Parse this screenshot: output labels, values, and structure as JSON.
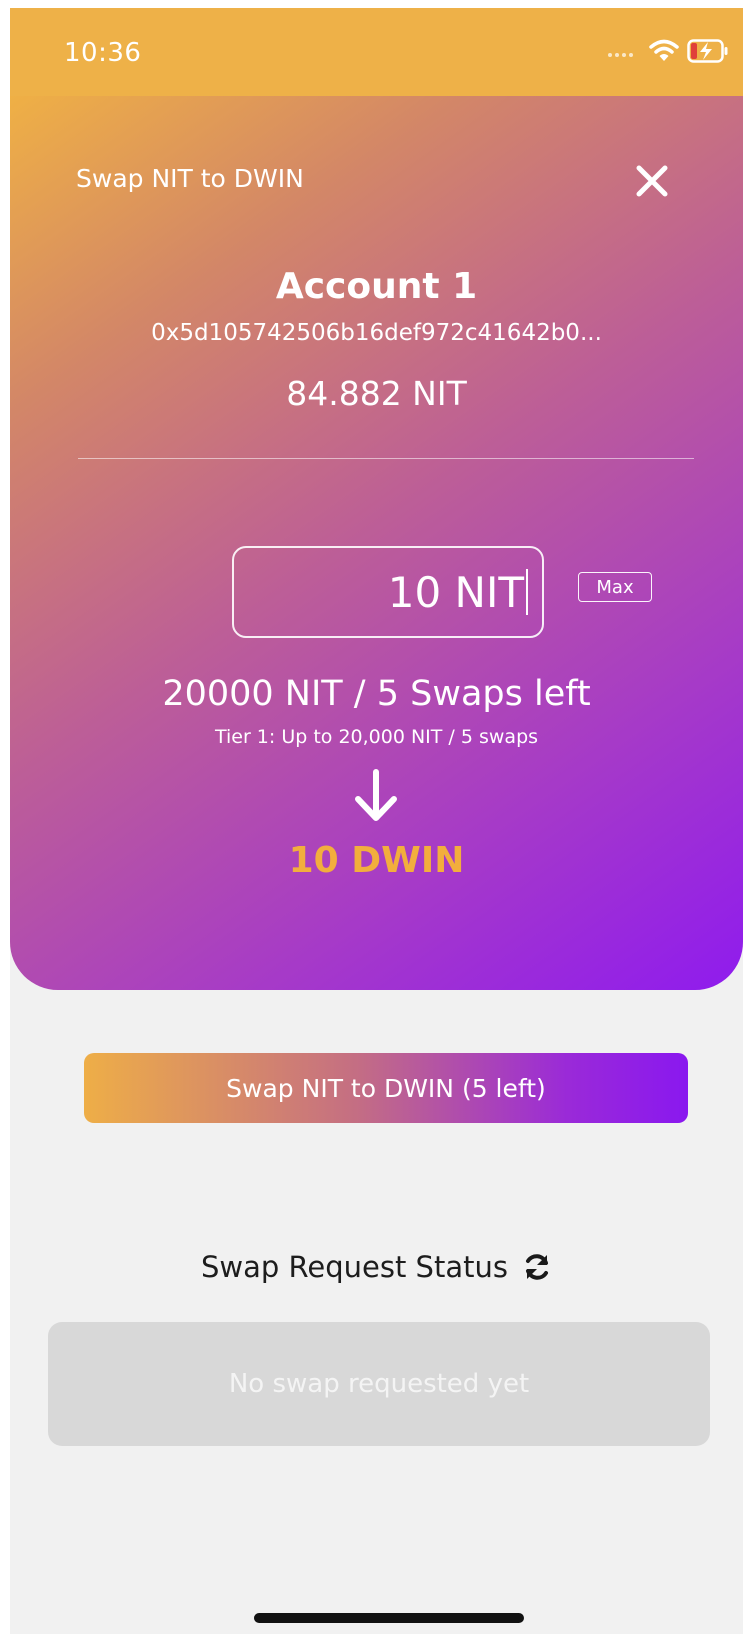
{
  "status_bar": {
    "time": "10:36",
    "icons": [
      "signal-icon",
      "wifi-icon",
      "battery-charging-icon"
    ],
    "color": "#eeb148"
  },
  "header": {
    "title": "Swap NIT to DWIN",
    "close_icon": "close-icon"
  },
  "account": {
    "name": "Account 1",
    "address": "0x5d105742506b16def972c41642b0...",
    "balance": "84.882 NIT"
  },
  "swap_form": {
    "amount_value": "10 NIT",
    "max_label": "Max",
    "limit_text": "20000 NIT / 5 Swaps left",
    "tier_text": "Tier 1: Up to 20,000 NIT / 5 swaps",
    "arrow_icon": "arrow-down-icon",
    "receive_amount": "10 DWIN",
    "receive_color": "#f2ae3d"
  },
  "swap_button": {
    "label": "Swap NIT to DWIN (5 left)"
  },
  "request_status": {
    "heading": "Swap Request Status",
    "refresh_icon": "refresh-icon",
    "empty_message": "No swap requested yet"
  },
  "colors": {
    "gradient_start": "#efb045",
    "gradient_end": "#8f1bee",
    "background": "#f1f1f1",
    "panel": "#d8d8d8"
  }
}
